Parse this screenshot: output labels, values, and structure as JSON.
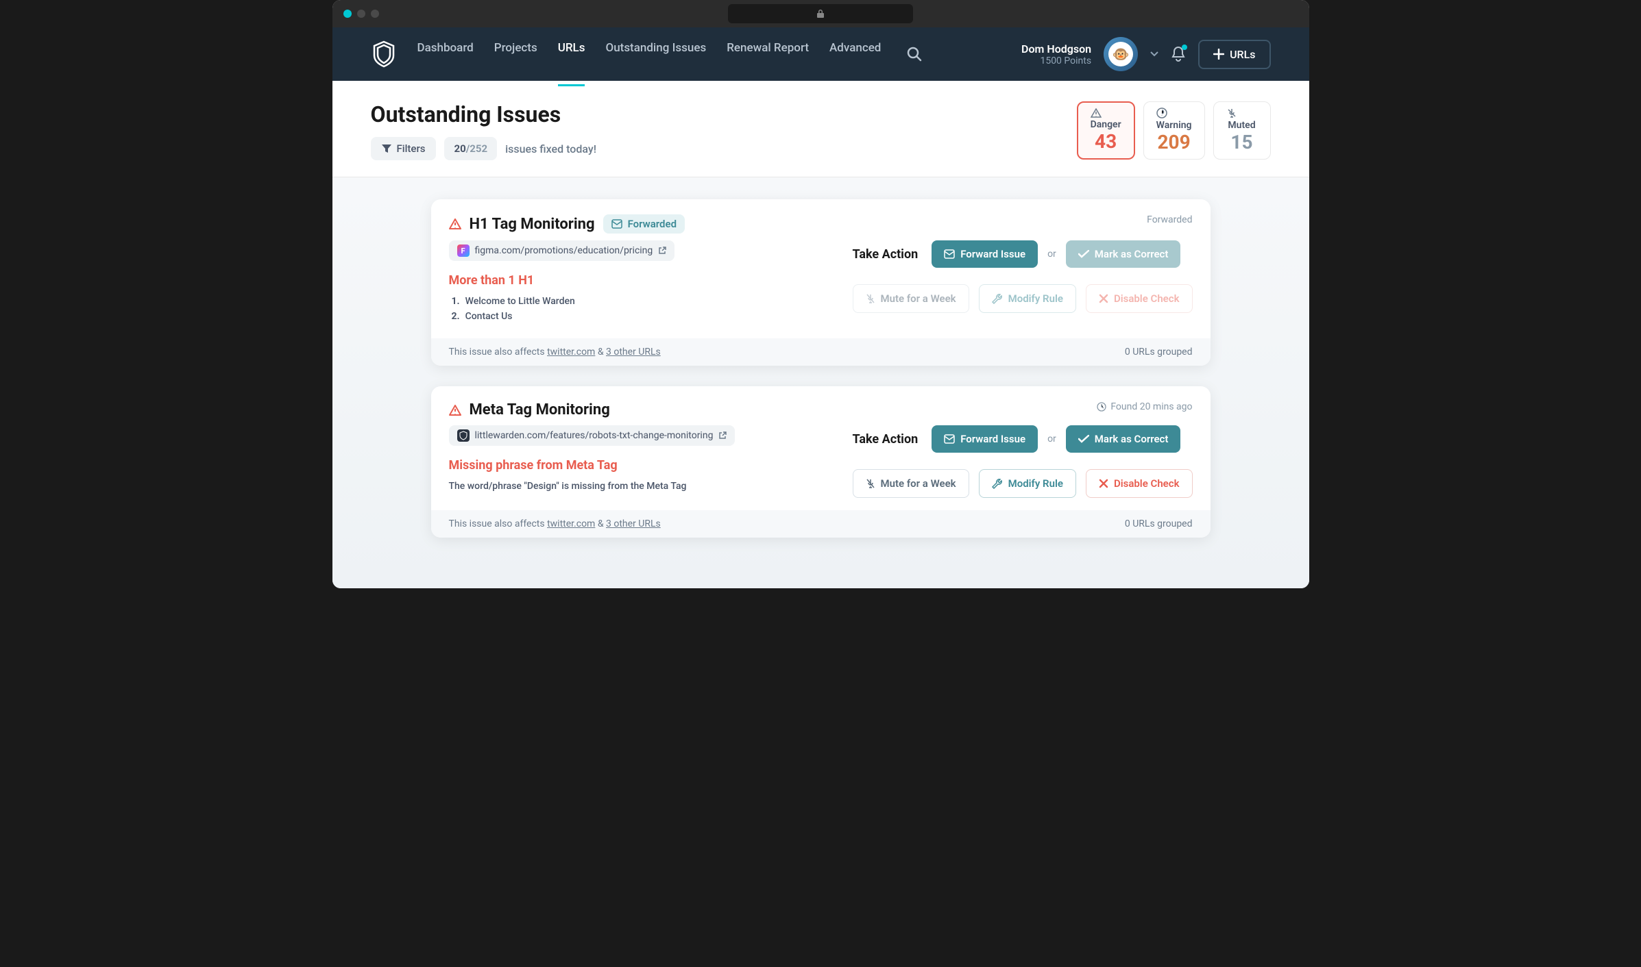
{
  "nav": {
    "links": [
      "Dashboard",
      "Projects",
      "URLs",
      "Outstanding Issues",
      "Renewal Report",
      "Advanced"
    ],
    "active_index": 2,
    "user_name": "Dom Hodgson",
    "user_points": "1500 Points",
    "urls_button": "URLs"
  },
  "page": {
    "title": "Outstanding Issues",
    "filters_label": "Filters",
    "fixed_count": "20",
    "fixed_total": "/252",
    "fixed_label": "issues fixed today!"
  },
  "stats": {
    "danger": {
      "label": "Danger",
      "value": "43"
    },
    "warning": {
      "label": "Warning",
      "value": "209"
    },
    "muted": {
      "label": "Muted",
      "value": "15"
    }
  },
  "actions": {
    "take_action": "Take Action",
    "forward": "Forward Issue",
    "mark_correct": "Mark as Correct",
    "or": "or",
    "mute": "Mute for a Week",
    "modify": "Modify Rule",
    "disable": "Disable Check"
  },
  "issues": [
    {
      "title": "H1 Tag Monitoring",
      "badge": "Forwarded",
      "meta": "Forwarded",
      "url": "figma.com/promotions/education/pricing",
      "desc": "More than 1 H1",
      "list": [
        "Welcome to Little Warden",
        "Contact Us"
      ],
      "footer_prefix": "This issue also affects ",
      "footer_link1": "twitter.com",
      "footer_amp": " & ",
      "footer_link2": "3 other URLs",
      "footer_right": "0 URLs grouped",
      "faded": true
    },
    {
      "title": "Meta Tag Monitoring",
      "meta": "Found 20 mins ago",
      "url": "littlewarden.com/features/robots-txt-change-monitoring",
      "desc": "Missing phrase from Meta Tag",
      "text": "The word/phrase \"Design\" is missing from the Meta Tag",
      "footer_prefix": "This issue also affects ",
      "footer_link1": "twitter.com",
      "footer_amp": " & ",
      "footer_link2": "3 other URLs",
      "footer_right": "0 URLs grouped",
      "faded": false
    }
  ]
}
